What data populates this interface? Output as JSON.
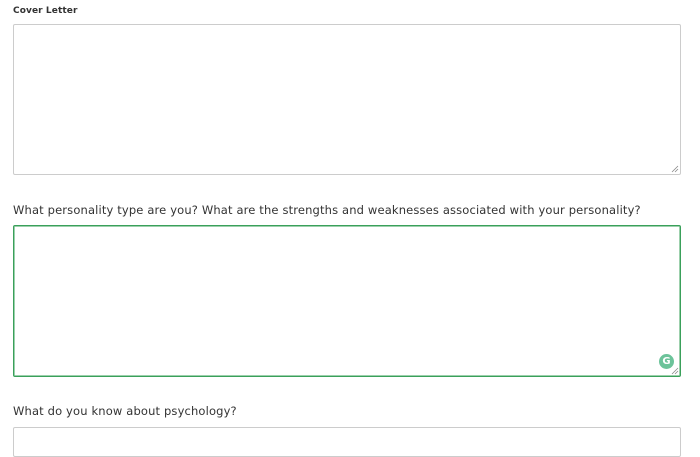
{
  "cover_letter": {
    "label": "Cover Letter",
    "value": ""
  },
  "question_personality": {
    "label": "What personality type are you? What are the strengths and weaknesses associated with your personality?",
    "value": "",
    "focused": true,
    "focus_color": "#3aa05a"
  },
  "question_psychology": {
    "label": "What do you know about psychology?",
    "value": ""
  },
  "icons": {
    "grammarly": "grammarly-icon",
    "grammarly_glyph": "G",
    "grammarly_color": "#6cc39a"
  }
}
